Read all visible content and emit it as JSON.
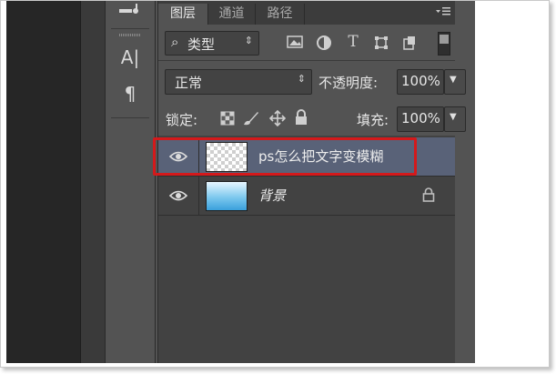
{
  "panel": {
    "tabs": [
      {
        "label": "图层",
        "active": true
      },
      {
        "label": "通道",
        "active": false
      },
      {
        "label": "路径",
        "active": false
      }
    ],
    "menu_icon": "panel-menu-icon"
  },
  "filter": {
    "search_glyph": "⌕",
    "kind_label": "类型",
    "icons": [
      "image-filter-icon",
      "adjustment-filter-icon",
      "type-filter-icon",
      "shape-filter-icon",
      "smart-object-filter-icon"
    ]
  },
  "blend": {
    "mode": "正常",
    "opacity_label": "不透明度:",
    "opacity_value": "100%"
  },
  "lock": {
    "label": "锁定:",
    "icons": [
      "lock-transparent-icon",
      "lock-brush-icon",
      "lock-move-icon",
      "lock-all-icon"
    ],
    "fill_label": "填充:",
    "fill_value": "100%"
  },
  "layers": [
    {
      "name": "ps怎么把文字变模糊",
      "selected": true,
      "thumbnail": "transparent",
      "locked": false
    },
    {
      "name": "背景",
      "selected": false,
      "thumbnail": "gradient-blue",
      "locked": true
    }
  ],
  "toolbar": {
    "tools": [
      "brush-tool-icon",
      "character-panel-icon",
      "paragraph-panel-icon"
    ],
    "char_glyph": "A|",
    "para_glyph": "¶"
  },
  "colors": {
    "highlight": "#d4191b",
    "selected_row": "#596278",
    "panel_bg": "#535353"
  }
}
